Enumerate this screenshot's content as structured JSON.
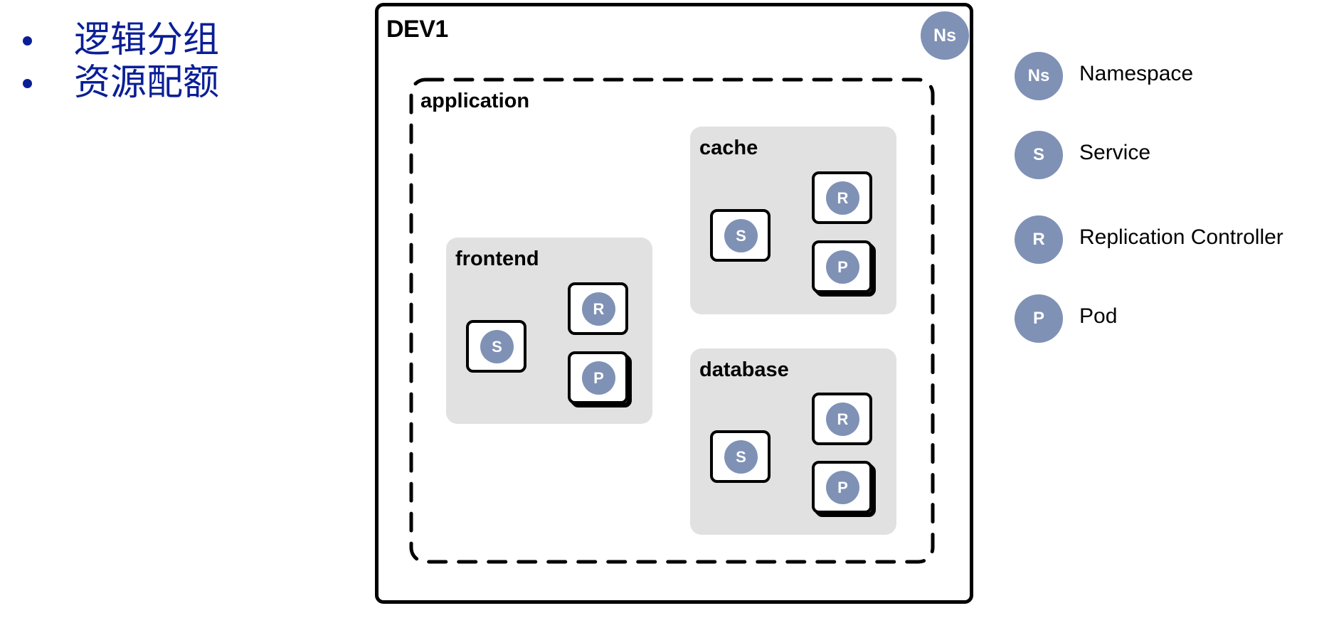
{
  "bullets": [
    {
      "text": "逻辑分组"
    },
    {
      "text": "资源配额"
    }
  ],
  "colors": {
    "bullet_text": "#0a1e96",
    "badge": "#7f91b5",
    "group_bg": "#e1e1e1",
    "border": "#000000"
  },
  "diagram": {
    "namespace": {
      "title": "DEV1",
      "badge": "Ns"
    },
    "application": {
      "title": "application"
    },
    "groups": [
      {
        "name": "frontend",
        "service": "S",
        "replication_controller": "R",
        "pod": "P"
      },
      {
        "name": "cache",
        "service": "S",
        "replication_controller": "R",
        "pod": "P"
      },
      {
        "name": "database",
        "service": "S",
        "replication_controller": "R",
        "pod": "P"
      }
    ]
  },
  "legend": [
    {
      "badge": "Ns",
      "label": "Namespace"
    },
    {
      "badge": "S",
      "label": "Service"
    },
    {
      "badge": "R",
      "label": "Replication Controller"
    },
    {
      "badge": "P",
      "label": "Pod"
    }
  ]
}
